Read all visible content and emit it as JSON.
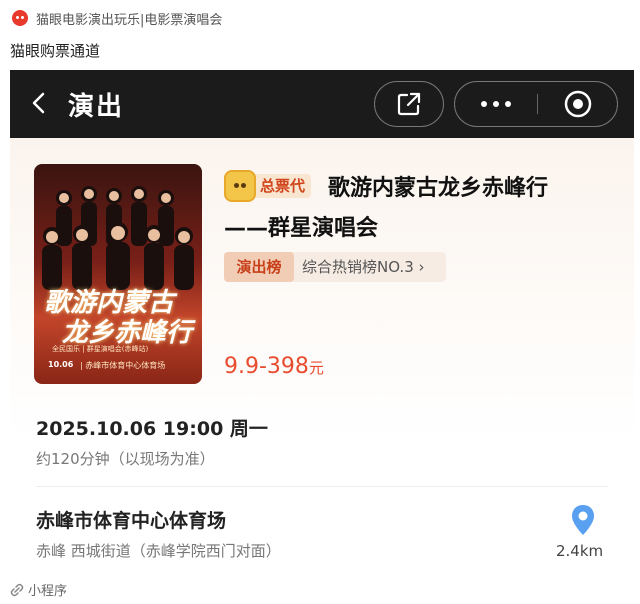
{
  "top": {
    "site_title": "猫眼电影演出玩乐|电影票演唱会",
    "subtitle": "猫眼购票通道"
  },
  "header": {
    "title": "演出",
    "icons": [
      "back-icon",
      "external-link-icon",
      "more-icon",
      "target-icon"
    ]
  },
  "event": {
    "badge": "总票代",
    "title_line1": "歌游内蒙古龙乡赤峰行",
    "title_line2": "——群星演唱会",
    "rank_label": "演出榜",
    "rank_value": "综合热销榜NO.3 ›",
    "price": "9.9-398",
    "price_unit": "元",
    "poster": {
      "title_line1": "歌游内蒙古",
      "title_line2": "龙乡赤峰行",
      "small_text": "全民国乐 | 群星演唱会(赤峰站)",
      "date": "10.06",
      "venue": "| 赤峰市体育中心体育场"
    }
  },
  "schedule": {
    "datetime": "2025.10.06 19:00 周一",
    "duration": "约120分钟（以现场为准）"
  },
  "location": {
    "venue": "赤峰市体育中心体育场",
    "address": "赤峰 西城街道（赤峰学院西门对面）",
    "distance": "2.4km"
  },
  "footer": {
    "label": "小程序"
  },
  "colors": {
    "accent": "#e84c2e",
    "header_bg": "#1b1b1b",
    "map_pin": "#5aa0f0"
  }
}
